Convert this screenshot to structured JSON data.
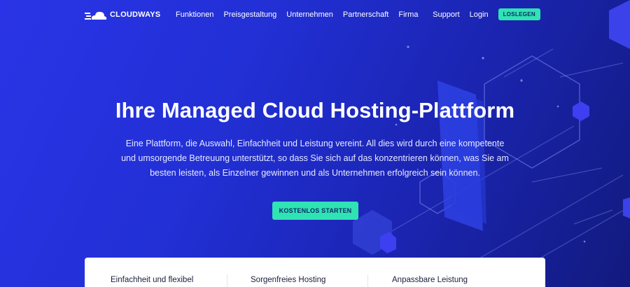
{
  "brand": {
    "name": "CLOUDWAYS"
  },
  "nav": {
    "links": [
      "Funktionen",
      "Preisgestaltung",
      "Unternehmen",
      "Partnerschaft",
      "Firma"
    ],
    "support": "Support",
    "login": "Login",
    "cta": "LOSLEGEN"
  },
  "hero": {
    "title": "Ihre Managed Cloud Hosting-Plattform",
    "description": "Eine Plattform, die Auswahl, Einfachheit und Leistung vereint. All dies wird durch eine kompetente und umsorgende Betreuung unterstützt, so dass Sie sich auf das konzentrieren können, was Sie am besten leisten, als Einzelner gewinnen und als Unternehmen erfolgreich sein können.",
    "cta": "KOSTENLOS STARTEN"
  },
  "features": [
    "Einfachheit und flexibel",
    "Sorgenfreies Hosting",
    "Anpassbare Leistung"
  ],
  "colors": {
    "accent": "#2fe3b3",
    "background": "#2230d6",
    "card": "#ffffff"
  },
  "icons": {
    "logo": "cloud-icon"
  }
}
